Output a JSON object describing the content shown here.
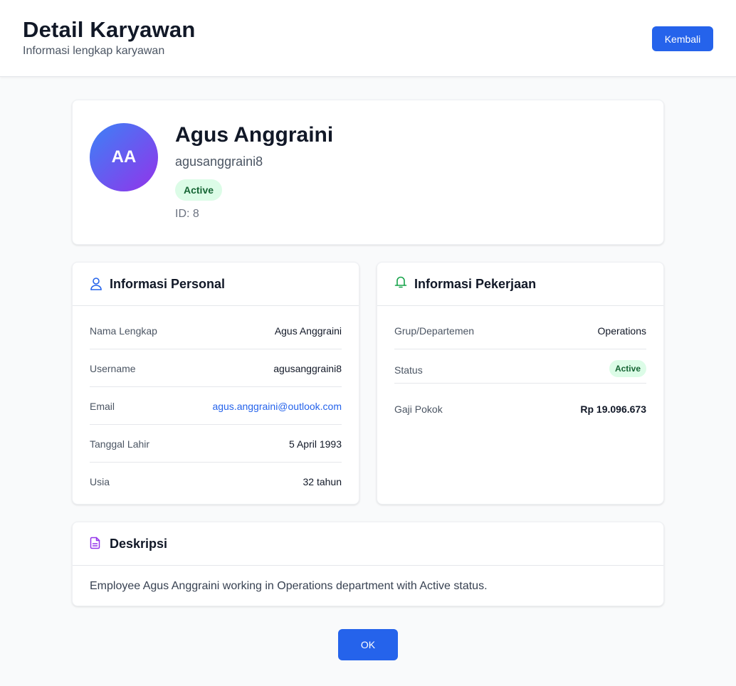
{
  "header": {
    "title": "Detail Karyawan",
    "subtitle": "Informasi lengkap karyawan",
    "back_label": "Kembali"
  },
  "profile": {
    "initials": "AA",
    "name": "Agus Anggraini",
    "username": "agusanggraini8",
    "status": "Active",
    "id_text": "ID: 8"
  },
  "personal": {
    "title": "Informasi Personal",
    "icon": "user-icon",
    "rows": [
      {
        "label": "Nama Lengkap",
        "value": "Agus Anggraini"
      },
      {
        "label": "Username",
        "value": "agusanggraini8"
      },
      {
        "label": "Email",
        "value": "agus.anggraini@outlook.com"
      },
      {
        "label": "Tanggal Lahir",
        "value": "5 April 1993"
      },
      {
        "label": "Usia",
        "value": "32 tahun"
      }
    ]
  },
  "job": {
    "title": "Informasi Pekerjaan",
    "icon": "briefcase-icon",
    "rows": [
      {
        "label": "Grup/Departemen",
        "value": "Operations"
      },
      {
        "label": "Status",
        "value": "Active"
      },
      {
        "label": "Gaji Pokok",
        "value": "Rp 19.096.673"
      }
    ]
  },
  "description": {
    "title": "Deskripsi",
    "icon": "document-icon",
    "text": "Employee Agus Anggraini working in Operations department with Active status."
  },
  "footer": {
    "ok_label": "OK"
  },
  "colors": {
    "primary": "#2563eb",
    "active_bg": "#dcfce7",
    "active_text": "#166534",
    "avatar_from": "#3b82f6",
    "avatar_to": "#9333ea"
  }
}
